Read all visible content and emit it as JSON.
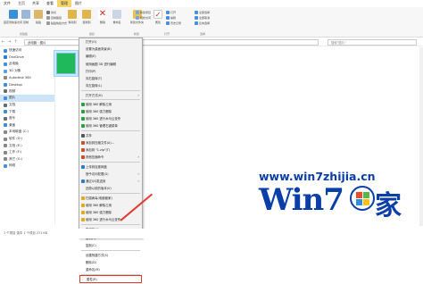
{
  "tabs": [
    {
      "label": "文件",
      "active": false
    },
    {
      "label": "主页",
      "active": false
    },
    {
      "label": "共享",
      "active": false
    },
    {
      "label": "查看",
      "active": false
    },
    {
      "label": "管理",
      "active": true
    },
    {
      "label": "图片",
      "active": false
    }
  ],
  "ribbon": {
    "groups": [
      {
        "name": "剪贴板",
        "buttons": [
          "固定到快速访问",
          "复制",
          "粘贴"
        ]
      },
      {
        "name": "组织",
        "buttons": [
          "移动到",
          "复制到",
          "删除",
          "重命名"
        ]
      },
      {
        "name": "新建",
        "buttons": [
          "新建文件夹"
        ]
      },
      {
        "name": "打开",
        "buttons": [
          "属性"
        ]
      },
      {
        "name": "选择",
        "buttons": [
          "全部选择",
          "全部取消",
          "反向选择"
        ]
      }
    ],
    "small": [
      "剪切",
      "复制路径",
      "粘贴快捷方式",
      "新建项目",
      "轻松访问",
      "打开",
      "编辑",
      "历史记录"
    ]
  },
  "address": {
    "path": "此电脑 › 图片",
    "search_placeholder": "搜索\"图片\""
  },
  "sidebar": {
    "items": [
      {
        "label": "快速访问",
        "icon": "star-icon",
        "color": "#3b8fd9"
      },
      {
        "label": "OneDrive",
        "icon": "cloud-icon",
        "color": "#2b7cd3"
      },
      {
        "label": "此电脑",
        "icon": "computer-icon",
        "color": "#4a90d9"
      },
      {
        "label": "3D 对象",
        "icon": "cube-icon",
        "color": "#5aa0e0"
      },
      {
        "label": "Autodesk 360",
        "icon": "cloud-icon",
        "color": "#888888"
      },
      {
        "label": "Desktop",
        "icon": "desktop-icon",
        "color": "#3b8fd9"
      },
      {
        "label": "视频",
        "icon": "video-icon",
        "color": "#6c6c6c"
      },
      {
        "label": "图片",
        "icon": "picture-icon",
        "color": "#4a90d9",
        "active": true
      },
      {
        "label": "文档",
        "icon": "document-icon",
        "color": "#6c6c6c"
      },
      {
        "label": "下载",
        "icon": "download-icon",
        "color": "#3b8fd9"
      },
      {
        "label": "音乐",
        "icon": "music-icon",
        "color": "#6c6c6c"
      },
      {
        "label": "桌面",
        "icon": "desktop-icon",
        "color": "#3b8fd9"
      },
      {
        "label": "本地磁盘 (C:)",
        "icon": "drive-icon",
        "color": "#888888"
      },
      {
        "label": "软件 (D:)",
        "icon": "drive-icon",
        "color": "#888888"
      },
      {
        "label": "文档 (E:)",
        "icon": "drive-icon",
        "color": "#888888"
      },
      {
        "label": "工作 (F:)",
        "icon": "drive-icon",
        "color": "#888888"
      },
      {
        "label": "其它 (G:)",
        "icon": "drive-icon",
        "color": "#888888"
      },
      {
        "label": "网络",
        "icon": "network-icon",
        "color": "#4a90d9"
      }
    ]
  },
  "context_menu": {
    "items": [
      {
        "label": "打开(O)",
        "icon": "",
        "arrow": false
      },
      {
        "label": "设置为桌面背景(B)",
        "icon": "",
        "arrow": false
      },
      {
        "label": "编辑(E)",
        "icon": "",
        "arrow": false
      },
      {
        "label": "使用画图 3D 进行编辑",
        "icon": "",
        "arrow": false
      },
      {
        "label": "打印(P)",
        "icon": "",
        "arrow": false
      },
      {
        "label": "向右旋转(T)",
        "icon": "",
        "arrow": false
      },
      {
        "label": "向左旋转(L)",
        "icon": "",
        "arrow": false
      },
      {
        "sep": true
      },
      {
        "label": "打开方式(H)",
        "icon": "",
        "arrow": true
      },
      {
        "sep": true
      },
      {
        "label": "使用 360 解除占用",
        "icon": "shield-icon",
        "color": "#2e9e3e",
        "arrow": false
      },
      {
        "label": "使用 360 强力删除",
        "icon": "shield-icon",
        "color": "#2e9e3e",
        "arrow": false
      },
      {
        "label": "使用 360 进行木马云查杀",
        "icon": "shield-icon",
        "color": "#2e9e3e",
        "arrow": false
      },
      {
        "label": "使用 360 管理右键菜单",
        "icon": "shield-icon",
        "color": "#2e9e3e",
        "arrow": false
      },
      {
        "sep": true
      },
      {
        "label": "共享",
        "icon": "share-icon",
        "color": "#555555",
        "arrow": false
      },
      {
        "label": "添加到压缩文件(A)...",
        "icon": "archive-icon",
        "color": "#c44f2b",
        "arrow": false
      },
      {
        "label": "添加到 \"1.zip\"(T)",
        "icon": "archive-icon",
        "color": "#c44f2b",
        "arrow": false
      },
      {
        "label": "其他压缩命令",
        "icon": "archive-icon",
        "color": "#c44f2b",
        "arrow": true
      },
      {
        "sep": true
      },
      {
        "label": "上传到百度网盘",
        "icon": "cloud-icon",
        "color": "#2b7cd3",
        "arrow": false
      },
      {
        "label": "授予访问权限(G)",
        "icon": "",
        "arrow": true
      },
      {
        "label": "通过QQ发送到",
        "icon": "qq-icon",
        "color": "#2b7cd3",
        "arrow": true
      },
      {
        "label": "还原以前的版本(V)",
        "icon": "",
        "arrow": false
      },
      {
        "sep": true
      },
      {
        "label": "扫描病毒(电脑管家)",
        "icon": "shield-icon",
        "color": "#e6a817",
        "arrow": false
      },
      {
        "label": "使用 360 解除占用",
        "icon": "shield-icon",
        "color": "#e6a817",
        "arrow": false
      },
      {
        "label": "使用 360 强力删除",
        "icon": "shield-icon",
        "color": "#e6a817",
        "arrow": false
      },
      {
        "label": "使用 360 进行木马云查杀",
        "icon": "shield-icon",
        "color": "#e6a817",
        "arrow": false
      },
      {
        "sep": true
      },
      {
        "label": "发送到(N)",
        "icon": "",
        "arrow": true
      },
      {
        "sep": true
      },
      {
        "label": "剪切(T)",
        "icon": "",
        "arrow": false
      },
      {
        "label": "复制(C)",
        "icon": "",
        "arrow": false
      },
      {
        "sep": true
      },
      {
        "label": "创建快捷方式(S)",
        "icon": "",
        "arrow": false
      },
      {
        "label": "删除(D)",
        "icon": "",
        "arrow": false
      },
      {
        "label": "重命名(M)",
        "icon": "",
        "arrow": false
      },
      {
        "sep": true
      },
      {
        "label": "属性(R)",
        "icon": "",
        "arrow": false,
        "highlight": true
      }
    ]
  },
  "status": "1 个项目   选中 1 个项目  271 KB",
  "watermark": {
    "url": "www.win7zhijia.cn",
    "logo": "Win7",
    "suffix": "家"
  },
  "colors": {
    "accent": "#f3d66a",
    "highlight_box": "#e23b2e",
    "watermark": "#0a3ea8",
    "thumbnail": "#1fb85a"
  }
}
